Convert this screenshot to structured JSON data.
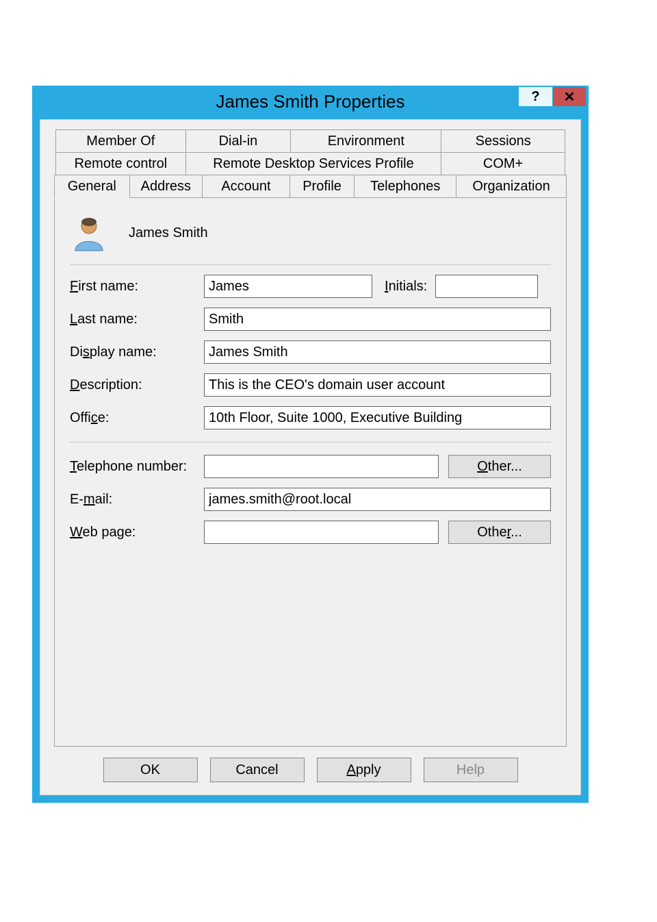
{
  "window": {
    "title": "James Smith Properties"
  },
  "tabs": {
    "row1": [
      "Member Of",
      "Dial-in",
      "Environment",
      "Sessions"
    ],
    "row2": [
      "Remote control",
      "Remote Desktop Services Profile",
      "COM+"
    ],
    "row3": [
      "General",
      "Address",
      "Account",
      "Profile",
      "Telephones",
      "Organization"
    ],
    "active": "General"
  },
  "header": {
    "name": "James Smith"
  },
  "fields": {
    "first_name": {
      "label_pre": "F",
      "label_post": "irst name:",
      "value": "James"
    },
    "initials": {
      "label_pre": "I",
      "label_post": "nitials:",
      "value": ""
    },
    "last_name": {
      "label_pre": "L",
      "label_post": "ast name:",
      "value": "Smith"
    },
    "display": {
      "label_pre": "Di",
      "label_u": "s",
      "label_post": "play name:",
      "value": "James Smith"
    },
    "description": {
      "label_pre": "D",
      "label_post": "escription:",
      "value": "This is the CEO's domain user account"
    },
    "office": {
      "label_pre": "Offi",
      "label_u": "c",
      "label_post": "e:",
      "value": "10th Floor, Suite 1000, Executive Building"
    },
    "telephone": {
      "label_pre": "T",
      "label_post": "elephone number:",
      "value": ""
    },
    "email": {
      "label_pre": "E-",
      "label_u": "m",
      "label_post": "ail:",
      "value": "james.smith@root.local"
    },
    "web": {
      "label_pre": "W",
      "label_post": "eb page:",
      "value": ""
    }
  },
  "buttons": {
    "other_tel_pre": "O",
    "other_tel_post": "ther...",
    "other_web_pre": "Othe",
    "other_web_u": "r",
    "other_web_post": "...",
    "ok": "OK",
    "cancel": "Cancel",
    "apply_pre": "A",
    "apply_post": "pply",
    "help": "Help"
  }
}
